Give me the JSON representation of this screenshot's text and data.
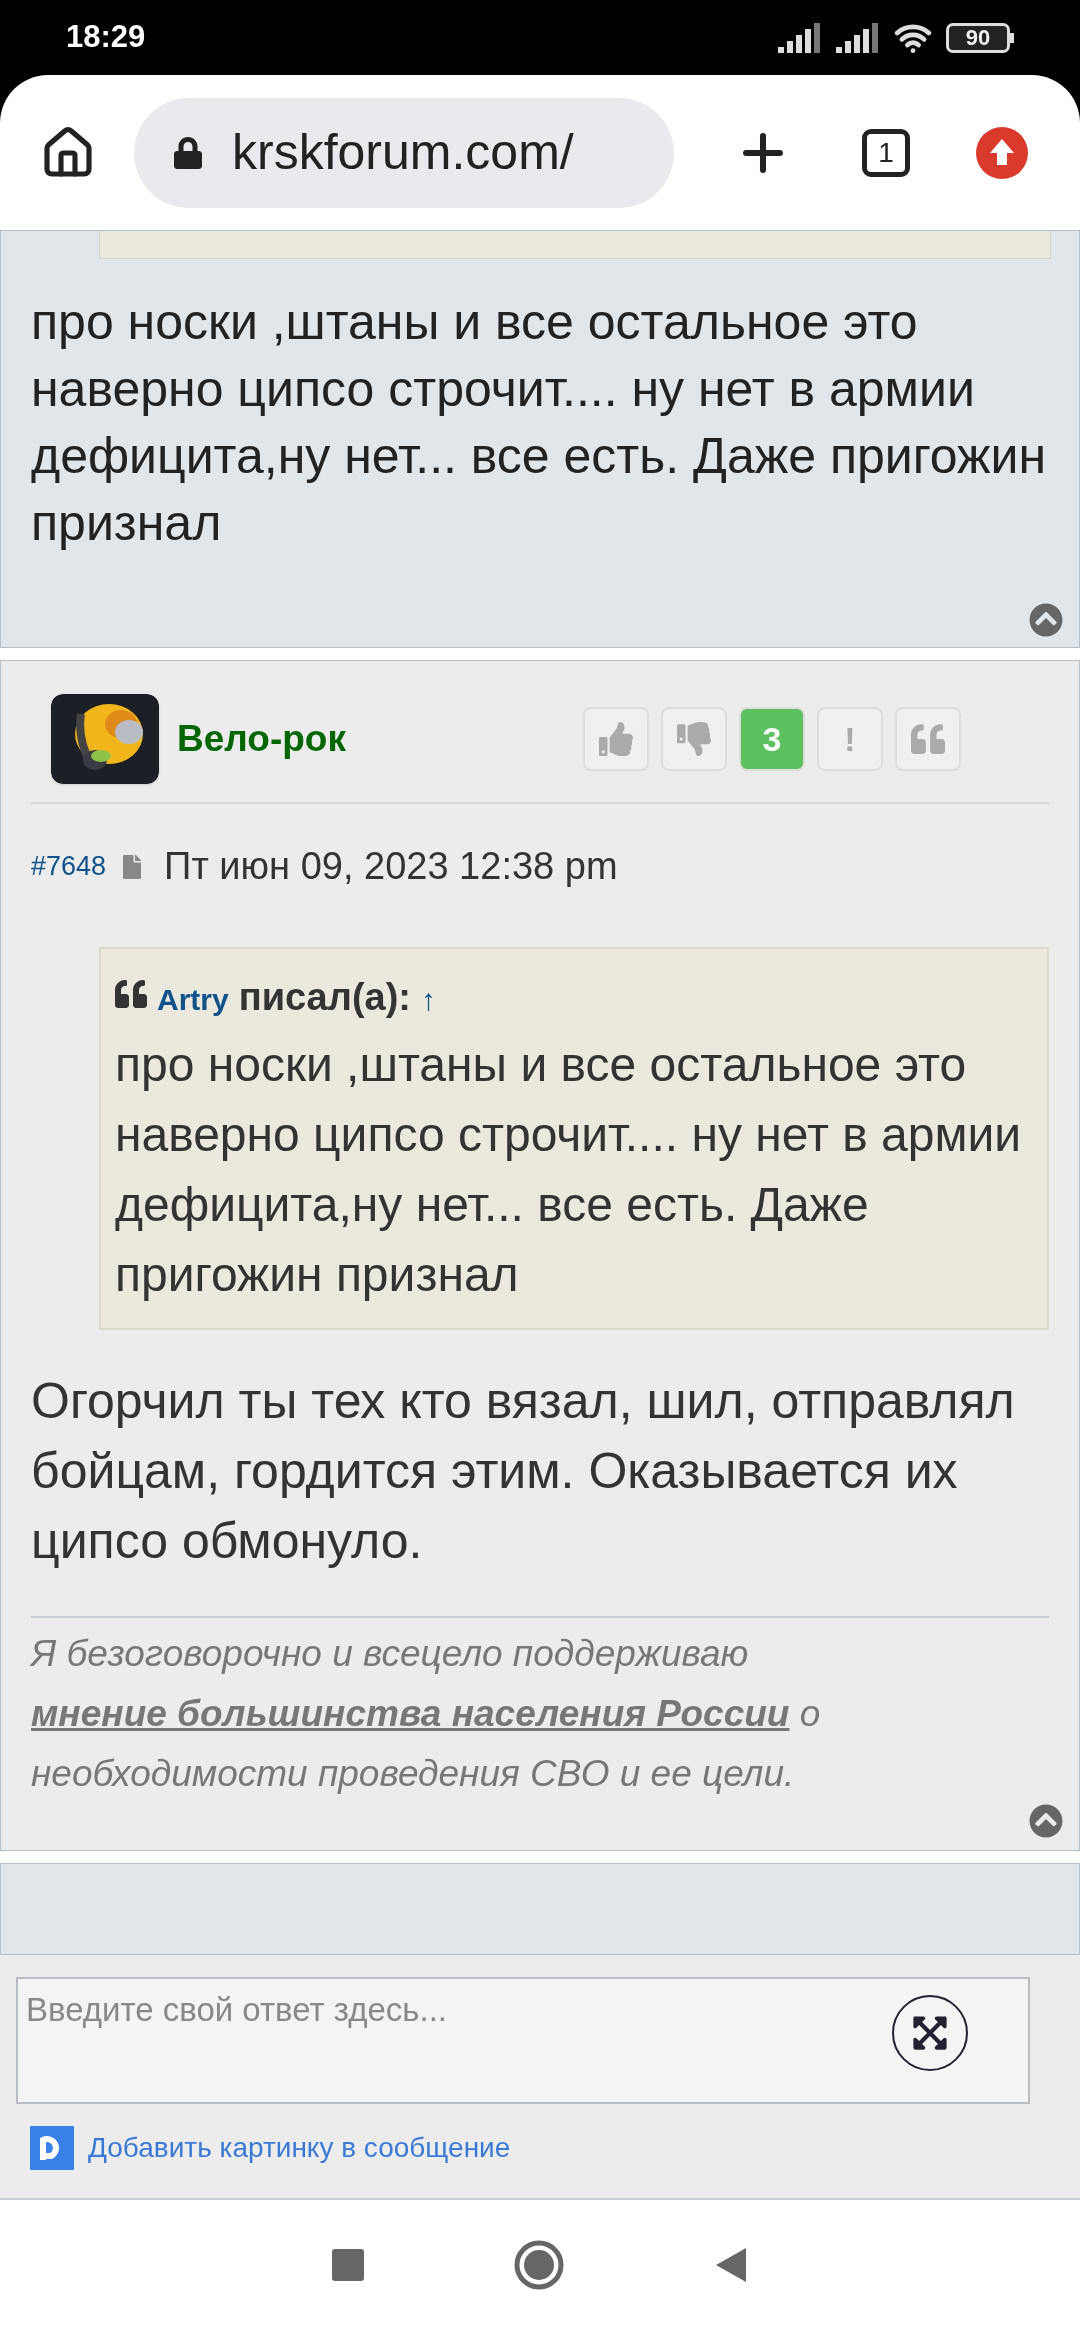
{
  "status_bar": {
    "time": "18:29",
    "battery": "90"
  },
  "browser": {
    "url": "krskforum.com/",
    "tab_count": "1"
  },
  "previous_post": {
    "text": "про носки ,штаны и все остальное это наверно ципсо строчит.... ну нет в армии дефицита,ну нет... все есть. Даже пригожин признал"
  },
  "post": {
    "author": "Вело-рок",
    "votes": [
      {
        "kind": "like"
      },
      {
        "kind": "dislike"
      },
      {
        "kind": "score",
        "label": "3"
      },
      {
        "kind": "report",
        "label": "!"
      },
      {
        "kind": "quote"
      }
    ],
    "number": "#7648",
    "date": "Пт июн 09, 2023 12:38 pm",
    "quote": {
      "author": "Artry",
      "verb": "писал(а):",
      "jump": "↑",
      "text": "про носки ,штаны и все остальное это наверно ципсо строчит.... ну нет в армии дефицита,ну нет... все есть. Даже пригожин признал"
    },
    "text": "Огорчил ты тех кто вязал, шил, отправлял бойцам, гордится этим. Оказывается их ципсо обмонуло.",
    "signature": {
      "before": "Я безоговорочно и всецело поддерживаю",
      "link": "мнение большинства населения России",
      "after": "о необходимости проведения СВО и ее цели."
    }
  },
  "reply": {
    "placeholder": "Введите свой ответ здесь...",
    "add_image": "Добавить картинку в сообщение"
  }
}
